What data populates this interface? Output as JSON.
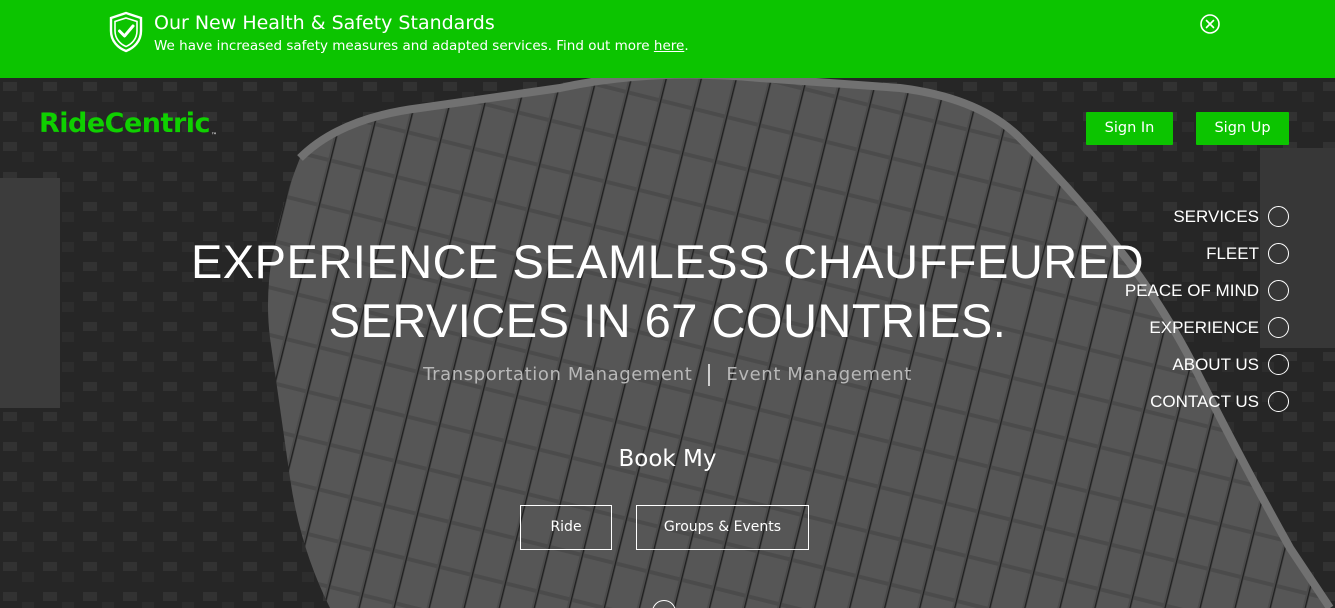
{
  "banner": {
    "title": "Our New Health & Safety Standards",
    "text": "We have increased safety measures and adapted services. Find out more ",
    "link": "here",
    "suffix": ".",
    "color": "#0cc400"
  },
  "brand": {
    "name": "RideCentric",
    "tm": "™",
    "color": "#0fd000"
  },
  "header": {
    "sign_in": "Sign In",
    "sign_up": "Sign Up"
  },
  "sidenav": [
    {
      "label": "SERVICES"
    },
    {
      "label": "FLEET"
    },
    {
      "label": "PEACE OF MIND"
    },
    {
      "label": "EXPERIENCE"
    },
    {
      "label": "ABOUT US"
    },
    {
      "label": "CONTACT US"
    }
  ],
  "hero": {
    "headline_line1": "EXPERIENCE SEAMLESS CHAUFFEURED",
    "headline_line2": "SERVICES IN 67 COUNTRIES.",
    "tag_left": "Transportation Management",
    "tag_right": "Event Management",
    "book_label": "Book My",
    "btn_ride": "Ride",
    "btn_groups": "Groups & Events"
  }
}
